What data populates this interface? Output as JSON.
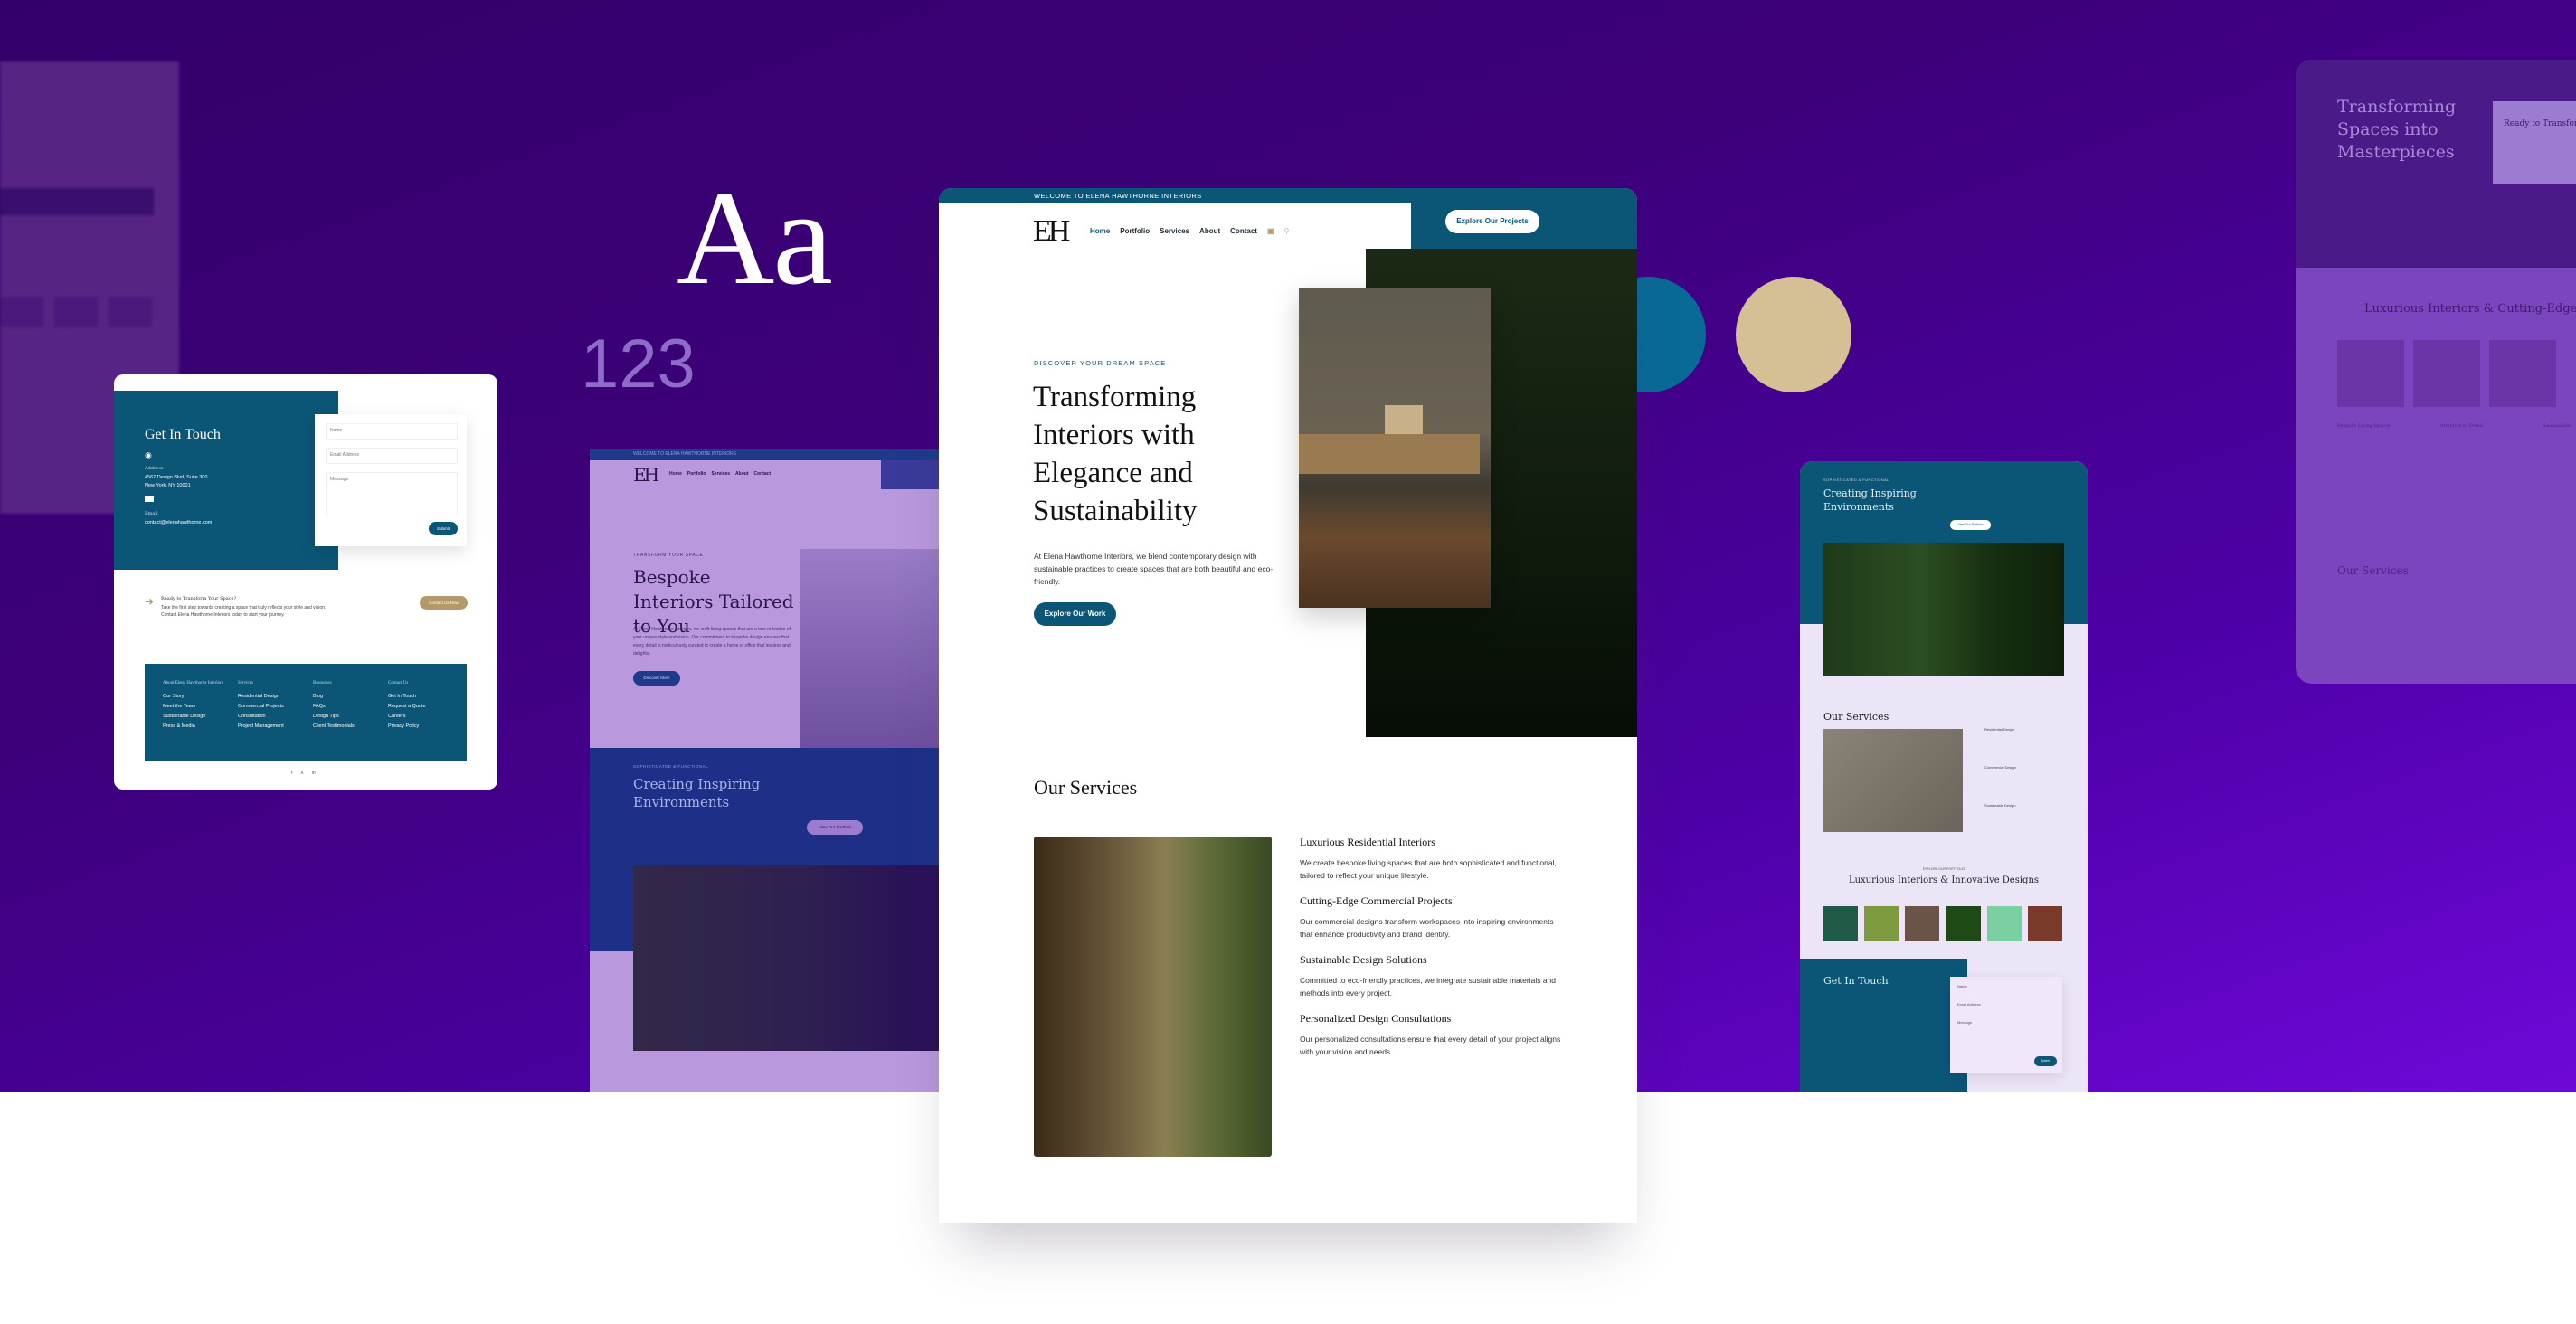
{
  "typography": {
    "sample_letters": "Aa",
    "sample_numbers": "123"
  },
  "palette": {
    "primary": "#0a6a97",
    "accent": "#d4c094",
    "brand_teal": "#0b5676",
    "background_purple": "#3c0078"
  },
  "main_page": {
    "topbar": "WELCOME TO ELENA HAWTHORNE INTERIORS",
    "logo": "EH",
    "nav": [
      "Home",
      "Portfolio",
      "Services",
      "About",
      "Contact"
    ],
    "nav_active": "Home",
    "cta": "Explore Our Projects",
    "hero": {
      "eyebrow": "DISCOVER YOUR DREAM SPACE",
      "title": "Transforming Interiors with Elegance and Sustainability",
      "description": "At Elena Hawthorne Interiors, we blend contemporary design with sustainable practices to create spaces that are both beautiful and eco-friendly.",
      "button": "Explore Our Work"
    },
    "services": {
      "title": "Our Services",
      "items": [
        {
          "title": "Luxurious Residential Interiors",
          "text": "We create bespoke living spaces that are both sophisticated and functional, tailored to reflect your unique lifestyle."
        },
        {
          "title": "Cutting-Edge Commercial Projects",
          "text": "Our commercial designs transform workspaces into inspiring environments that enhance productivity and brand identity."
        },
        {
          "title": "Sustainable Design Solutions",
          "text": "Committed to eco-friendly practices, we integrate sustainable materials and methods into every project."
        },
        {
          "title": "Personalized Design Consultations",
          "text": "Our personalized consultations ensure that every detail of your project aligns with your vision and needs."
        }
      ]
    }
  },
  "contact_card": {
    "title": "Get In Touch",
    "address_label": "Address",
    "address": "4567 Design Blvd, Suite 300",
    "city": "New York, NY 10001",
    "email_label": "Email",
    "email": "contact@elenahawthorne.com",
    "form": {
      "name": "Name",
      "email": "Email Address",
      "message": "Message",
      "submit": "Submit"
    },
    "cta_title": "Ready to Transform Your Space?",
    "cta_text": "Take the first step towards creating a space that truly reflects your style and vision. Contact Elena Hawthorne Interiors today to start your journey.",
    "cta_button": "Contact Us Now",
    "footer": [
      {
        "heading": "About Elena Hawthorne Interiors",
        "links": [
          "Our Story",
          "Meet the Team",
          "Sustainable Design",
          "Press & Media"
        ]
      },
      {
        "heading": "Services",
        "links": [
          "Residential Design",
          "Commercial Projects",
          "Consultation",
          "Project Management"
        ]
      },
      {
        "heading": "Resources",
        "links": [
          "Blog",
          "FAQs",
          "Design Tips",
          "Client Testimonials"
        ]
      },
      {
        "heading": "Contact Us",
        "links": [
          "Get In Touch",
          "Request a Quote",
          "Careers",
          "Privacy Policy"
        ]
      }
    ],
    "social": [
      "f",
      "X",
      "in"
    ]
  },
  "bespoke_page": {
    "topbar": "WELCOME TO ELENA HAWTHORNE INTERIORS",
    "logo": "EH",
    "nav": [
      "Home",
      "Portfolio",
      "Services",
      "About",
      "Contact"
    ],
    "eyebrow": "TRANSFORM YOUR SPACE",
    "title": "Bespoke Interiors Tailored to You",
    "description": "At Elena Hawthorne Interiors, we craft living spaces that are a true reflection of your unique style and vision. Our commitment to bespoke design ensures that every detail is meticulously curated to create a home or office that inspires and delights.",
    "button": "Discover More",
    "section_eyebrow": "SOPHISTICATED & FUNCTIONAL",
    "section_title": "Creating Inspiring Environments",
    "section_button": "View Our Portfolio"
  },
  "mobile_page": {
    "eyebrow": "SOPHISTICATED & FUNCTIONAL",
    "title": "Creating Inspiring Environments",
    "button": "View Our Portfolio",
    "services_title": "Our Services",
    "services": [
      "Residential Design",
      "Commercial Design",
      "Sustainable Design"
    ],
    "portfolio_eyebrow": "EXPLORE OUR PORTFOLIO",
    "portfolio_title": "Luxurious Interiors & Innovative Designs",
    "contact_title": "Get In Touch",
    "form": {
      "name": "Name",
      "email": "Email Address",
      "message": "Message",
      "submit": "Submit"
    }
  },
  "right_ghost": {
    "title": "Transforming Spaces into Masterpieces",
    "cta_title": "Ready to Transform",
    "section_title": "Luxurious Interiors & Cutting-Edge Pr",
    "columns": [
      "Bespoke Living Spaces",
      "Attention to Detail",
      "Sustainable"
    ],
    "services_title": "Our Services"
  }
}
